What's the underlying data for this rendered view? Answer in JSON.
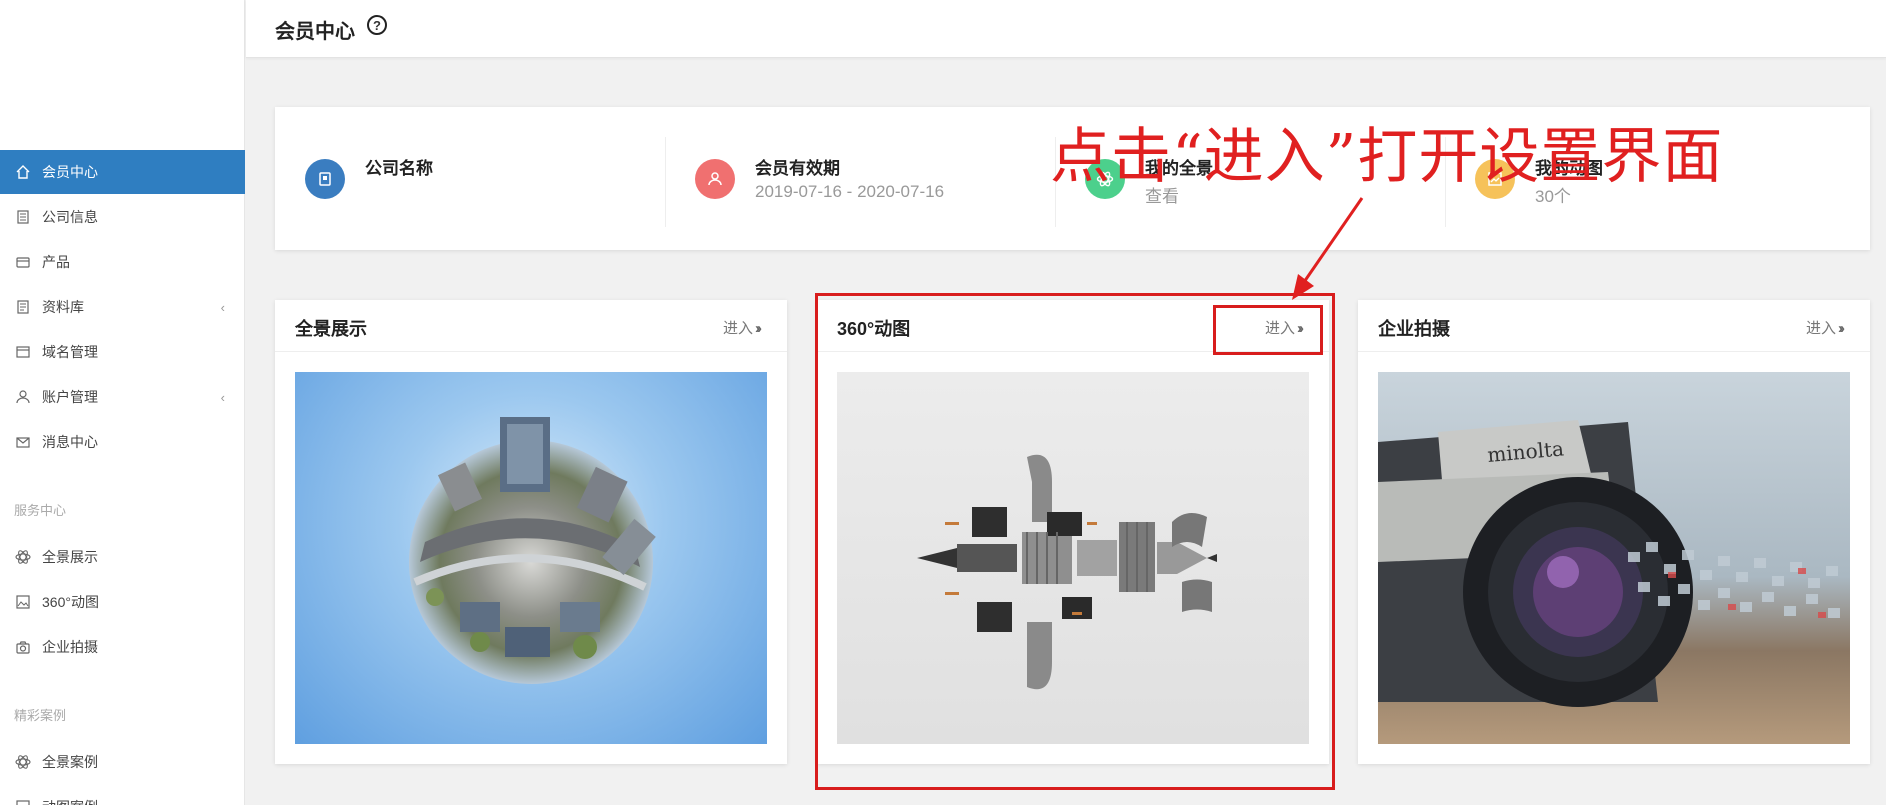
{
  "header": {
    "title": "会员中心",
    "help_icon": "question-circle-icon"
  },
  "sidebar": {
    "items": [
      {
        "label": "会员中心",
        "icon": "home-icon",
        "active": true
      },
      {
        "label": "公司信息",
        "icon": "building-icon"
      },
      {
        "label": "产品",
        "icon": "card-icon"
      },
      {
        "label": "资料库",
        "icon": "document-icon",
        "arrow": "‹"
      },
      {
        "label": "域名管理",
        "icon": "window-icon"
      },
      {
        "label": "账户管理",
        "icon": "user-icon",
        "arrow": "‹"
      },
      {
        "label": "消息中心",
        "icon": "mail-icon"
      }
    ],
    "section_service": "服务中心",
    "service_items": [
      {
        "label": "全景展示",
        "icon": "atom-icon"
      },
      {
        "label": "360°动图",
        "icon": "picture-icon"
      },
      {
        "label": "企业拍摄",
        "icon": "camera-icon"
      }
    ],
    "section_cases": "精彩案例",
    "case_items": [
      {
        "label": "全景案例",
        "icon": "atom-icon"
      },
      {
        "label": "动图案例",
        "icon": "picture-icon"
      }
    ]
  },
  "summary": {
    "company": {
      "label": "公司名称",
      "value": "",
      "icon": "badge-icon",
      "color": "#3a7dc0"
    },
    "membership": {
      "label": "会员有效期",
      "value": "2019-07-16 - 2020-07-16",
      "icon": "person-icon",
      "color": "#f07070"
    },
    "panorama": {
      "label": "我的全景",
      "value": "查看",
      "icon": "atom-icon",
      "color": "#4cd08c"
    },
    "animation": {
      "label": "我的动图",
      "value": "30个",
      "icon": "picture-icon",
      "color": "#f6c25a"
    }
  },
  "cards": [
    {
      "title": "全景展示",
      "enter": "进入",
      "image": "tiny-planet-panorama"
    },
    {
      "title": "360°动图",
      "enter": "进入",
      "image": "exploded-engine-model"
    },
    {
      "title": "企业拍摄",
      "enter": "进入",
      "image": "minolta-camera-photo"
    }
  ],
  "annotation": {
    "text": "点击“进入”打开设置界面",
    "color": "#e02020"
  }
}
